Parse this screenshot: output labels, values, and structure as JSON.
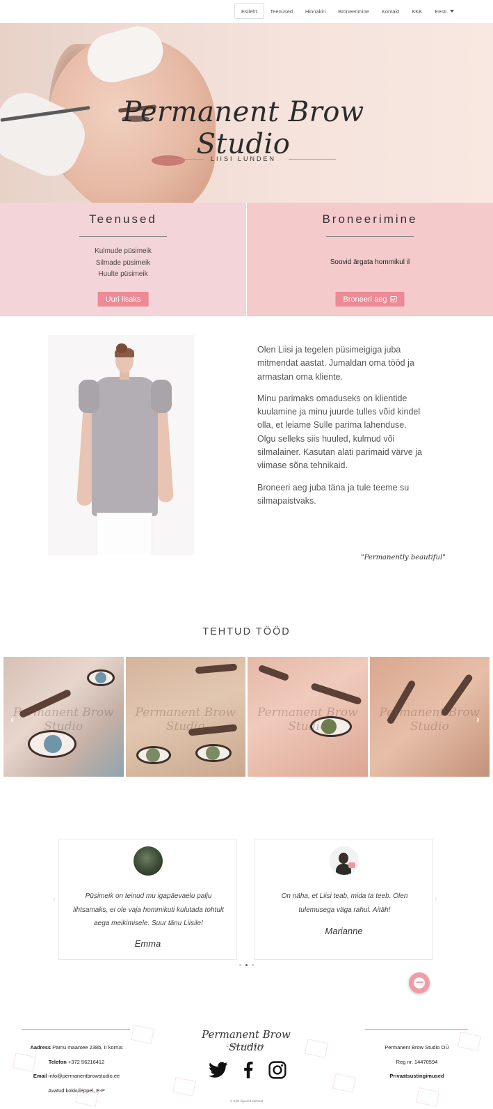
{
  "nav": {
    "items": [
      "Esileht",
      "Teenused",
      "Hinnakiri",
      "Broneerimine",
      "Kontakt",
      "KKK",
      "Eesti"
    ]
  },
  "hero": {
    "title": "Permanent Brow Studio",
    "subtitle": "LIISI LUNDEN"
  },
  "services": {
    "title": "Teenused",
    "items": [
      "Kulmude püsimeik",
      "Silmade püsimeik",
      "Huulte püsimeik"
    ],
    "button": "Uuri lisaks"
  },
  "booking": {
    "title": "Broneerimine",
    "text": "Soovid ärgata hommikul il",
    "button": "Broneeri aeg"
  },
  "about": {
    "paragraphs": [
      "Olen Liisi ja tegelen püsimeigiga juba mitmendat aastat.  Jumaldan oma tööd ja armastan oma kliente.",
      "Minu parimaks omaduseks on klientide kuulamine ja minu juurde tulles võid kindel olla, et leiame Sulle parima lahenduse. Olgu selleks siis huuled, kulmud või silmalainer. Kasutan alati parimaid värve ja viimase sõna tehnikaid.",
      "Broneeri aeg juba täna ja tule teeme su silmapaistvaks."
    ],
    "signature": "\"Permanently beautiful\""
  },
  "gallery": {
    "title": "TEHTUD TÖÖD",
    "watermark": "Permanent Brow Studio",
    "prev": "‹",
    "next": "›"
  },
  "testimonials": [
    {
      "quote": "Püsimeik on teinud mu igapäevaelu palju lihtsamaks, ei ole vaja hommikuti kulutada tohtult aega meikimisele. Suur tänu Liisile!",
      "name": "Emma"
    },
    {
      "quote": "On näha, et Liisi teab, mida ta teeb. Olen tulemusega väga rahul. Aitäh!",
      "name": "Marianne"
    }
  ],
  "footer": {
    "address_label": "Aadress",
    "address": "Pärnu maantee 238b, II korrus",
    "phone_label": "Telefon",
    "phone": "+372 56216412",
    "email_label": "Email",
    "email": "info@permanentbrowstudio.ee",
    "hours": "Avatud kokkuleppel, E-P",
    "logo": "Permanent Brow Studio",
    "logo_sub": "LIISI LUNDEN",
    "company": "Permanent Brow Studio OÜ",
    "reg": "Reg nr. 14470594",
    "privacy": "Privaatsustingimused",
    "copyright": "© Kõik õigused kaitstud"
  },
  "colors": {
    "accent": "#ec8a95",
    "box_left": "#f3d4d8",
    "box_right": "#f4cacb"
  }
}
